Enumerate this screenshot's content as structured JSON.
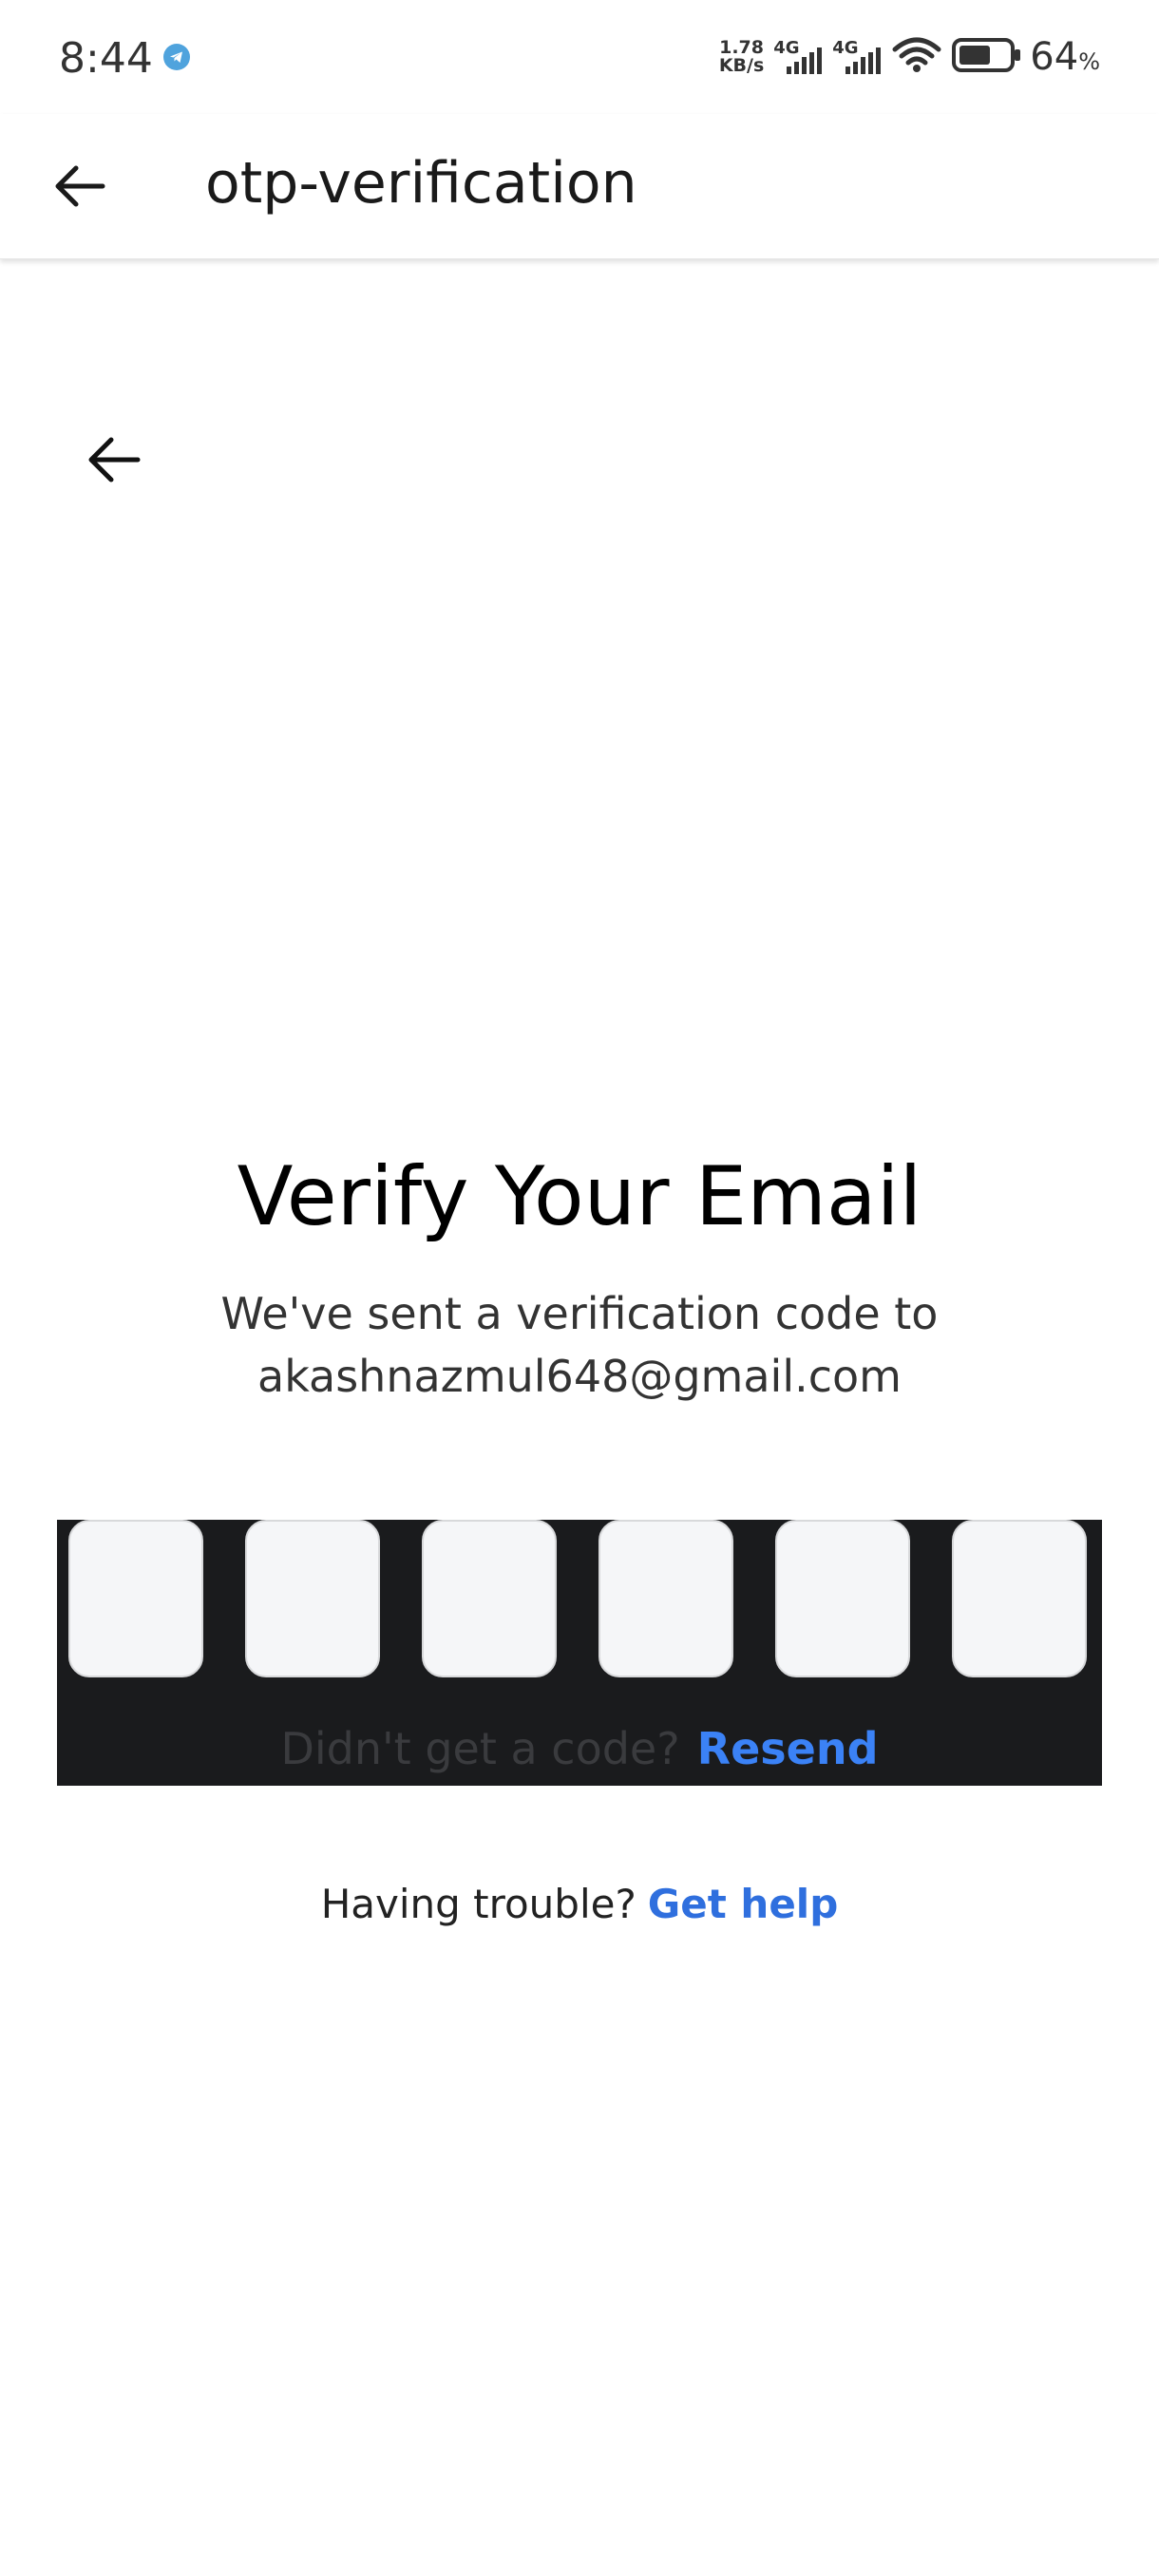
{
  "status_bar": {
    "time": "8:44",
    "net_speed_value": "1.78",
    "net_speed_unit": "KB/s",
    "sim1_type": "4G",
    "sim2_type": "4G",
    "battery_percent": "64",
    "battery_symbol": "%",
    "battery_level": 0.64
  },
  "app_bar": {
    "title": "otp-verification"
  },
  "main": {
    "heading": "Verify Your Email",
    "subtext_line1": "We've sent a verification code to",
    "email": "akashnazmul648@gmail.com",
    "otp_digits": [
      "",
      "",
      "",
      "",
      "",
      ""
    ],
    "resend_prompt": "Didn't get a code?",
    "resend_label": "Resend",
    "help_prompt": "Having trouble?",
    "help_label": "Get help"
  },
  "colors": {
    "accent": "#3b82f6",
    "otp_panel_bg": "#1a1b1d",
    "otp_box_bg": "#f5f6f8"
  }
}
